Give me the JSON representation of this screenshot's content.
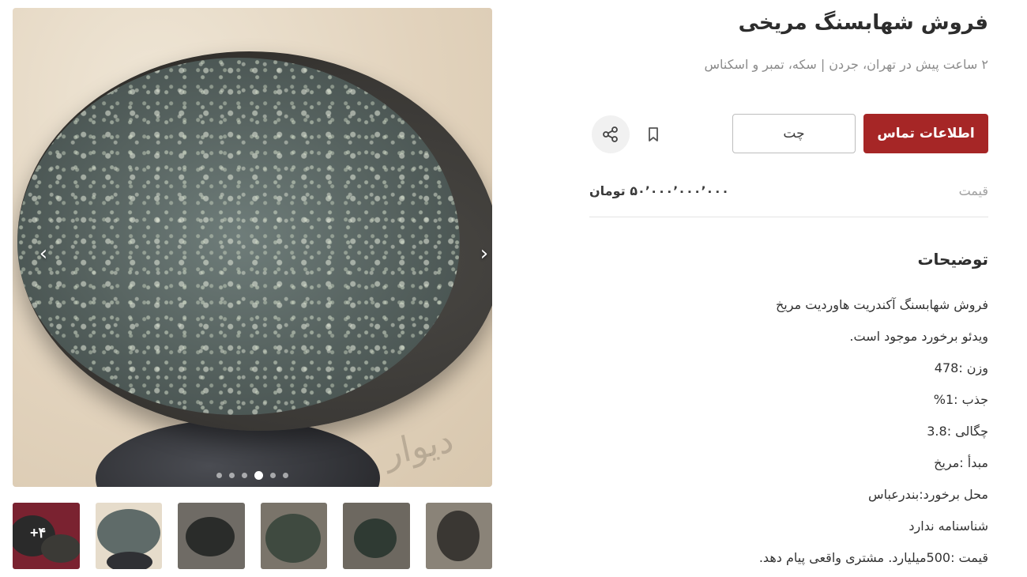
{
  "listing": {
    "title": "فروش شهابسنگ مریخی",
    "subtitle": "۲ ساعت پیش در تهران، جردن | سکه، تمبر و اسکناس",
    "contact_label": "اطلاعات تماس",
    "chat_label": "چت",
    "price_label": "قیمت",
    "price_value": "۵۰٬۰۰۰٬۰۰۰٬۰۰۰ تومان",
    "description_title": "توضیحات",
    "description_lines": [
      "فروش شهابسنگ آکندریت هاوردیت مریخ",
      "ویدئو برخورد موجود است.",
      "وزن :478",
      "جذب :1%",
      "چگالی :3.8",
      "مبدأ :مریخ",
      "محل برخورد:بندرعباس",
      "شناسنامه ندارد",
      "قیمت :500میلیارد. مشتری واقعی پیام دهد."
    ]
  },
  "gallery": {
    "watermark": "دیوار",
    "dots_count": 6,
    "active_dot_index": 3,
    "more_label": "+۴",
    "thumbnails_count": 6
  },
  "icons": {
    "prev": "chevron-left-icon",
    "next": "chevron-right-icon",
    "bookmark": "bookmark-icon",
    "share": "share-icon"
  },
  "colors": {
    "primary": "#a62626",
    "muted_text": "#8b8b8b",
    "divider": "#e3e3e3"
  }
}
